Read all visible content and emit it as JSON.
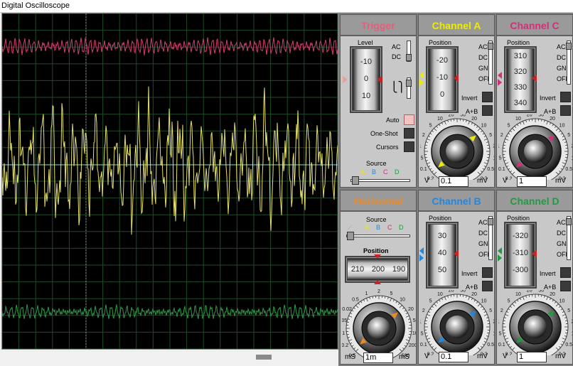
{
  "window": {
    "title": "Digital Oscilloscope"
  },
  "colors": {
    "trigger": "#e0607a",
    "channel_a": "#ecec00",
    "channel_b": "#1e88e5",
    "channel_c": "#d0307a",
    "channel_d": "#209a40",
    "horizontal": "#f08a20",
    "trace_a": "#e6e26a",
    "trace_c": "#d33d73",
    "trace_d": "#2f9a4a"
  },
  "trigger": {
    "title": "Trigger",
    "level_label": "Level",
    "level_ticks": [
      "-10",
      "0",
      "10"
    ],
    "coupling": [
      "AC",
      "DC"
    ],
    "auto": "Auto",
    "oneshot": "One-Shot",
    "cursors": "Cursors",
    "source_label": "Source",
    "sources": [
      "A",
      "B",
      "C",
      "D"
    ]
  },
  "horizontal": {
    "title": "Horizontal",
    "source_label": "Source",
    "sources": [
      "A",
      "B",
      "C",
      "D"
    ],
    "position_label": "Position",
    "position_ticks": [
      "210",
      "200",
      "190"
    ],
    "dial_scale": [
      "0.5",
      "0.2",
      "0.1",
      "0.05",
      "0.02",
      "0.5",
      "1",
      "2",
      "5",
      "10",
      "20",
      "50",
      "100",
      "200",
      "500"
    ],
    "unit_left": "mS",
    "unit_right": "mS",
    "value": "1m",
    "extra_left": "200",
    "extra_right": "0.5"
  },
  "channels": [
    {
      "id": "a",
      "title": "Channel A",
      "position_label": "Position",
      "ticks": [
        "-20",
        "-10",
        "0"
      ],
      "modes": [
        "AC",
        "DC",
        "GND",
        "OFF"
      ],
      "invert": "Invert",
      "apb": "A+B",
      "unit_left": "V",
      "unit_right": "mV",
      "value": "0.1"
    },
    {
      "id": "c",
      "title": "Channel C",
      "position_label": "Position",
      "ticks": [
        "310",
        "320",
        "330",
        "340"
      ],
      "modes": [
        "AC",
        "DC",
        "GND",
        "OFF"
      ],
      "invert": "Invert",
      "apb": "A+B",
      "unit_left": "V",
      "unit_right": "mV",
      "value": "1"
    },
    {
      "id": "b",
      "title": "Channel B",
      "position_label": "Position",
      "ticks": [
        "30",
        "40",
        "50"
      ],
      "modes": [
        "AC",
        "DC",
        "GND",
        "OFF"
      ],
      "invert": "Invert",
      "apb": "A+B",
      "unit_left": "V",
      "unit_right": "mV",
      "value": "0.1"
    },
    {
      "id": "d",
      "title": "Channel D",
      "position_label": "Position",
      "ticks": [
        "-320",
        "-310",
        "-300"
      ],
      "modes": [
        "AC",
        "DC",
        "GND",
        "OFF"
      ],
      "invert": "Invert",
      "apb": "A+B",
      "unit_left": "V",
      "unit_right": "mV",
      "value": "1"
    }
  ],
  "volt_dial_scale": [
    "0.2",
    "0.1",
    "0.5",
    "1",
    "2",
    "5",
    "10",
    "20",
    "50",
    "20",
    "10",
    "5",
    "2",
    "1",
    "0.5",
    "0.2"
  ]
}
